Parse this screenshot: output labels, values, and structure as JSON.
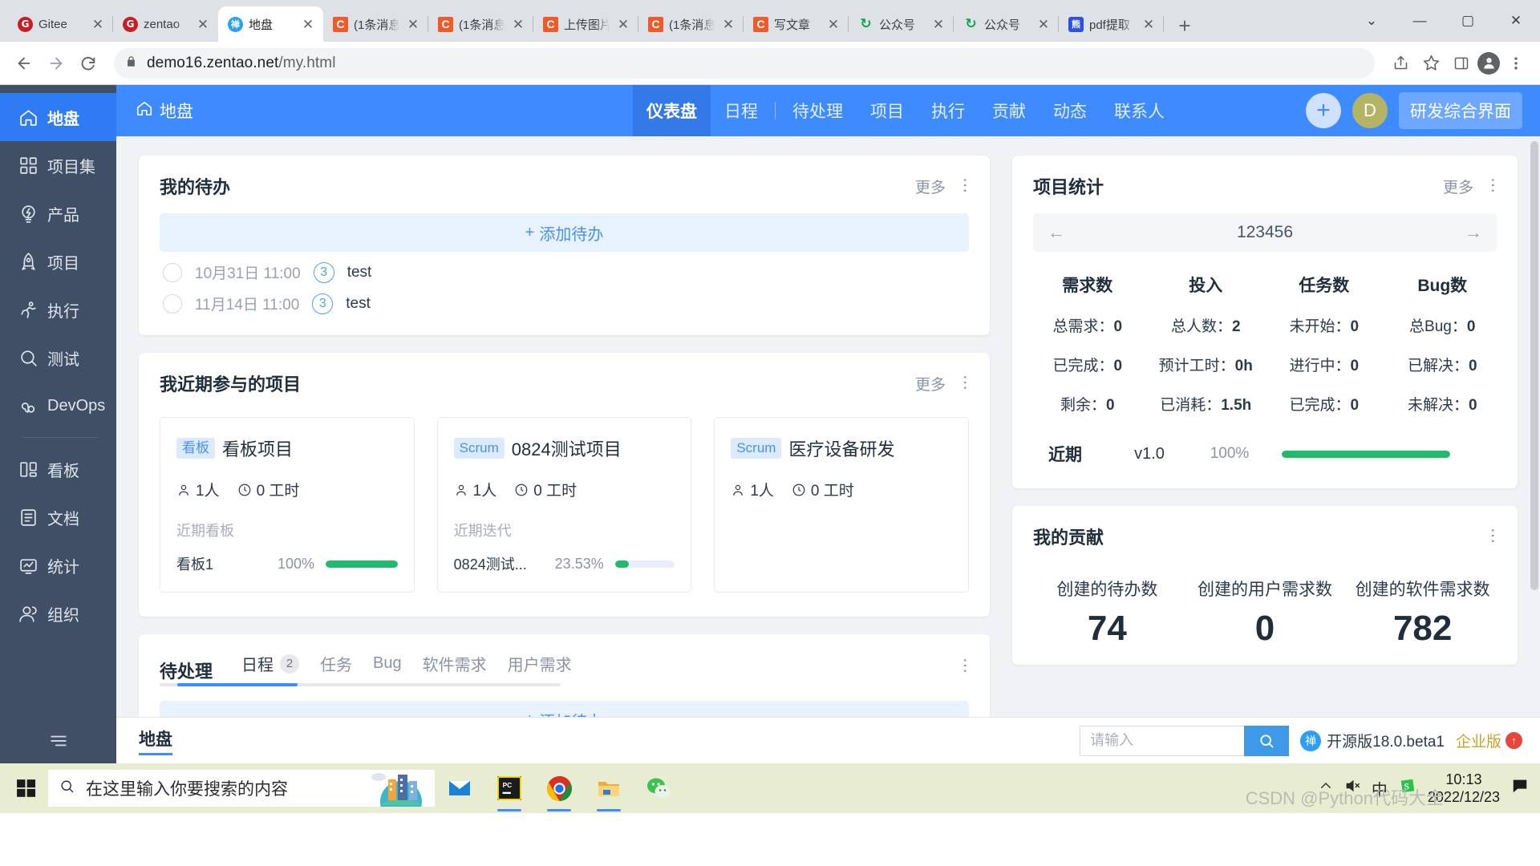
{
  "browser": {
    "tabs": [
      {
        "title": "Gitee",
        "favicon": "gitee-icon",
        "active": false
      },
      {
        "title": "zentao",
        "favicon": "gitee-icon",
        "active": false
      },
      {
        "title": "地盘",
        "favicon": "zentao-icon",
        "active": true
      },
      {
        "title": "(1条消息)",
        "favicon": "csdn-icon",
        "active": false
      },
      {
        "title": "(1条消息)",
        "favicon": "csdn-icon",
        "active": false
      },
      {
        "title": "上传图片",
        "favicon": "csdn-icon",
        "active": false
      },
      {
        "title": "(1条消息)",
        "favicon": "csdn-icon",
        "active": false
      },
      {
        "title": "写文章",
        "favicon": "csdn-icon",
        "active": false
      },
      {
        "title": "公众号",
        "favicon": "wechat-mp-icon",
        "active": false
      },
      {
        "title": "公众号",
        "favicon": "wechat-mp-icon",
        "active": false
      },
      {
        "title": "pdf提取",
        "favicon": "baidu-icon",
        "active": false
      }
    ],
    "new_tab_label": "+",
    "window_controls": {
      "minimize": "—",
      "maximize": "▢",
      "close": "✕",
      "chevron": "⌄"
    },
    "url_host": "demo16.zentao.net",
    "url_path": "/my.html"
  },
  "sidebar": {
    "items": [
      {
        "label": "地盘",
        "icon": "home-icon",
        "active": true
      },
      {
        "label": "项目集",
        "icon": "grid-icon",
        "active": false
      },
      {
        "label": "产品",
        "icon": "bulb-icon",
        "active": false
      },
      {
        "label": "项目",
        "icon": "rocket-icon",
        "active": false
      },
      {
        "label": "执行",
        "icon": "run-icon",
        "active": false
      },
      {
        "label": "测试",
        "icon": "search-circle-icon",
        "active": false
      },
      {
        "label": "DevOps",
        "icon": "infinity-icon",
        "active": false
      }
    ],
    "items2": [
      {
        "label": "看板",
        "icon": "kanban-icon",
        "active": false
      },
      {
        "label": "文档",
        "icon": "doc-icon",
        "active": false
      },
      {
        "label": "统计",
        "icon": "chart-icon",
        "active": false
      },
      {
        "label": "组织",
        "icon": "users-icon",
        "active": false
      }
    ],
    "collapse_label": "≡"
  },
  "header": {
    "brand": "地盘",
    "nav": [
      {
        "label": "仪表盘",
        "active": true
      },
      {
        "label": "日程",
        "active": false
      },
      {
        "label": "待处理",
        "active": false
      },
      {
        "label": "项目",
        "active": false
      },
      {
        "label": "执行",
        "active": false
      },
      {
        "label": "贡献",
        "active": false
      },
      {
        "label": "动态",
        "active": false
      },
      {
        "label": "联系人",
        "active": false
      }
    ],
    "add_label": "+",
    "avatar_initial": "D",
    "scheme_label": "研发综合界面"
  },
  "todo_card": {
    "title": "我的待办",
    "more": "更多",
    "add_label": "添加待办",
    "items": [
      {
        "time": "10月31日 11:00",
        "priority": "3",
        "name": "test"
      },
      {
        "time": "11月14日 11:00",
        "priority": "3",
        "name": "test"
      }
    ]
  },
  "projects_card": {
    "title": "我近期参与的项目",
    "more": "更多",
    "items": [
      {
        "badge": "看板",
        "name": "看板项目",
        "members": "1人",
        "hours": "0 工时",
        "sub_label": "近期看板",
        "progress": {
          "name": "看板1",
          "percent": "100%",
          "value": 100
        }
      },
      {
        "badge": "Scrum",
        "name": "0824测试项目",
        "members": "1人",
        "hours": "0 工时",
        "sub_label": "近期迭代",
        "progress": {
          "name": "0824测试...",
          "percent": "23.53%",
          "value": 23.53
        }
      },
      {
        "badge": "Scrum",
        "name": "医疗设备研发",
        "members": "1人",
        "hours": "0 工时",
        "sub_label": "",
        "progress": null
      }
    ]
  },
  "pending_card": {
    "title": "待处理",
    "tabs": [
      {
        "label": "日程",
        "count": "2",
        "active": true
      },
      {
        "label": "任务",
        "count": "",
        "active": false
      },
      {
        "label": "Bug",
        "count": "",
        "active": false
      },
      {
        "label": "软件需求",
        "count": "",
        "active": false
      },
      {
        "label": "用户需求",
        "count": "",
        "active": false
      }
    ],
    "add_label": "添加待办"
  },
  "stats_card": {
    "title": "项目统计",
    "more": "更多",
    "project_name": "123456",
    "prev_label": "←",
    "next_label": "→",
    "columns": [
      "需求数",
      "投入",
      "任务数",
      "Bug数"
    ],
    "rows": [
      [
        {
          "label": "总需求：",
          "value": "0"
        },
        {
          "label": "总人数：",
          "value": "2"
        },
        {
          "label": "未开始：",
          "value": "0"
        },
        {
          "label": "总Bug：",
          "value": "0"
        }
      ],
      [
        {
          "label": "已完成：",
          "value": "0"
        },
        {
          "label": "预计工时：",
          "value": "0h"
        },
        {
          "label": "进行中：",
          "value": "0"
        },
        {
          "label": "已解决：",
          "value": "0"
        }
      ],
      [
        {
          "label": "剩余：",
          "value": "0"
        },
        {
          "label": "已消耗：",
          "value": "1.5h"
        },
        {
          "label": "已完成：",
          "value": "0"
        },
        {
          "label": "未解决：",
          "value": "0"
        }
      ]
    ],
    "recent": {
      "label": "近期",
      "version": "v1.0",
      "percent": "100%",
      "value": 100
    }
  },
  "contrib_card": {
    "title": "我的贡献",
    "items": [
      {
        "label": "创建的待办数",
        "value": "74"
      },
      {
        "label": "创建的用户需求数",
        "value": "0"
      },
      {
        "label": "创建的软件需求数",
        "value": "782"
      }
    ]
  },
  "footer": {
    "tab": "地盘",
    "search_placeholder": "请输入",
    "search_value": "",
    "version": "开源版18.0.beta1",
    "enterprise": "企业版"
  },
  "taskbar": {
    "search_placeholder": "在这里输入你要搜索的内容",
    "time": "10:13",
    "date": "2022/12/23",
    "ime": "中",
    "watermark": "CSDN @Python代码大全"
  },
  "colors": {
    "brand_blue": "#3e8bff",
    "sidebar": "#404f65",
    "green": "#22bb6d",
    "accent_badge": "#dceafd"
  }
}
